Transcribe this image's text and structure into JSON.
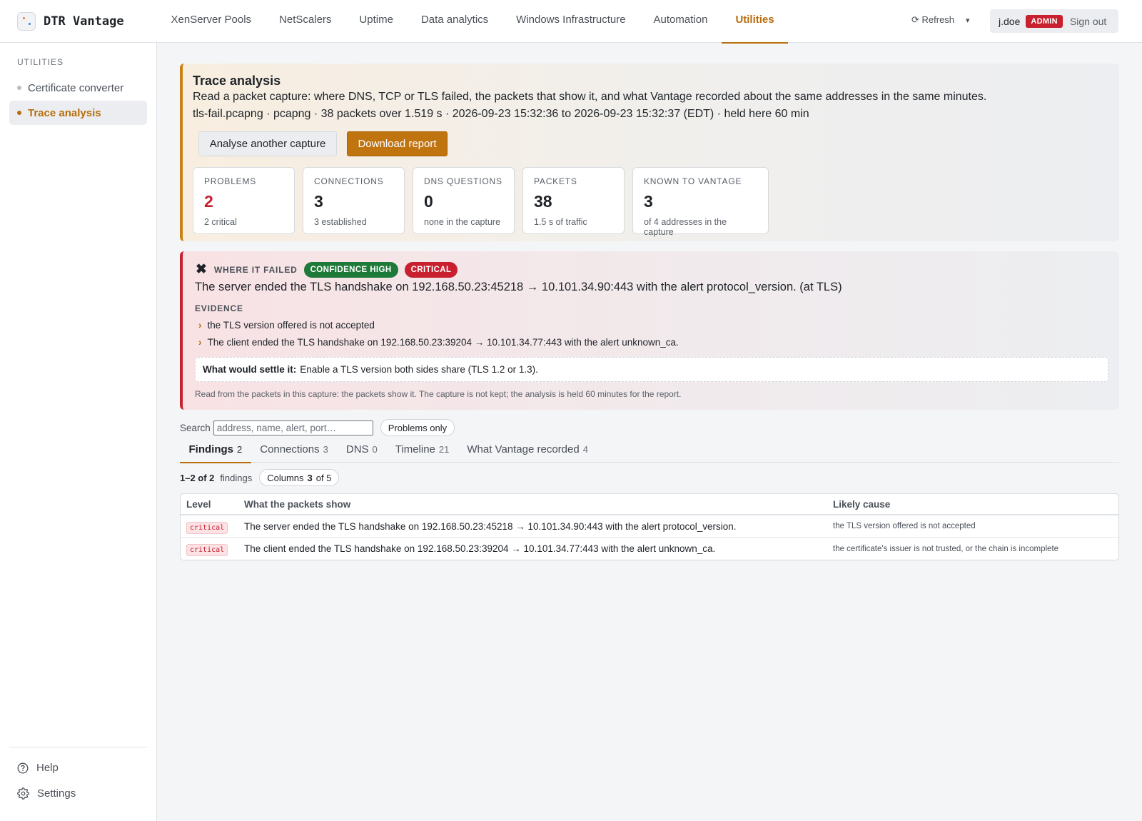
{
  "app": {
    "name": "DTR Vantage"
  },
  "nav": {
    "items": [
      {
        "label": "XenServer Pools",
        "active": false
      },
      {
        "label": "NetScalers",
        "active": false
      },
      {
        "label": "Uptime",
        "active": false
      },
      {
        "label": "Data analytics",
        "active": false
      },
      {
        "label": "Windows Infrastructure",
        "active": false
      },
      {
        "label": "Automation",
        "active": false
      },
      {
        "label": "Utilities",
        "active": true
      }
    ],
    "refresh_label": "⟳ Refresh",
    "refresh_caret": "▾",
    "user": "j.doe",
    "role_badge": "ADMIN",
    "signout_label": "Sign out"
  },
  "sidebar": {
    "heading": "UTILITIES",
    "items": [
      {
        "label": "Certificate converter",
        "active": false
      },
      {
        "label": "Trace analysis",
        "active": true
      }
    ],
    "footer": {
      "help_label": "Help",
      "settings_label": "Settings"
    }
  },
  "trace": {
    "title": "Trace analysis",
    "description": "Read a packet capture: where DNS, TCP or TLS failed, the packets that show it, and what Vantage recorded about the same addresses in the same minutes.",
    "meta": "tls-fail.pcapng · pcapng · 38 packets over 1.519 s · 2026-09-23 15:32:36 to 2026-09-23 15:32:37 (EDT) · held here 60 min",
    "analyse_button": "Analyse another capture",
    "download_button": "Download report",
    "stats": [
      {
        "label": "PROBLEMS",
        "value": "2",
        "sub": "2 critical"
      },
      {
        "label": "CONNECTIONS",
        "value": "3",
        "sub": "3 established"
      },
      {
        "label": "DNS QUESTIONS",
        "value": "0",
        "sub": "none in the capture"
      },
      {
        "label": "PACKETS",
        "value": "38",
        "sub": "1.5 s of traffic"
      },
      {
        "label": "KNOWN TO VANTAGE",
        "value": "3",
        "sub": "of 4 addresses in the capture"
      }
    ]
  },
  "failure": {
    "icon": "✖",
    "heading": "WHERE IT FAILED",
    "confidence_badge": "CONFIDENCE HIGH",
    "severity_badge": "CRITICAL",
    "statement": "The server ended the TLS handshake on 192.168.50.23:45218 → 10.101.34.90:443 with the alert protocol_version. (at TLS)",
    "evidence_heading": "EVIDENCE",
    "evidence": [
      "the TLS version offered is not accepted",
      "The client ended the TLS handshake on 192.168.50.23:39204 → 10.101.34.77:443 with the alert unknown_ca."
    ],
    "bullet_glyph": "›",
    "settle_label": "What would settle it:",
    "settle_text": "Enable a TLS version both sides share (TLS 1.2 or 1.3).",
    "note": "Read from the packets in this capture: the packets show it. The capture is not kept; the analysis is held 60 minutes for the report."
  },
  "search": {
    "label": "Search",
    "placeholder": "address, name, alert, port…",
    "value": "",
    "problems_only_label": "Problems only"
  },
  "tabs": [
    {
      "label": "Findings",
      "count": "2",
      "active": true
    },
    {
      "label": "Connections",
      "count": "3",
      "active": false
    },
    {
      "label": "DNS",
      "count": "0",
      "active": false
    },
    {
      "label": "Timeline",
      "count": "21",
      "active": false
    },
    {
      "label": "What Vantage recorded",
      "count": "4",
      "active": false
    }
  ],
  "findings": {
    "range": "1–2 of 2",
    "noun": "findings",
    "columns_label": "Columns",
    "columns_shown": "3",
    "columns_total": "of 5",
    "headers": [
      "Level",
      "What the packets show",
      "Likely cause"
    ],
    "rows": [
      {
        "level": "critical",
        "show": "The server ended the TLS handshake on 192.168.50.23:45218 → 10.101.34.90:443 with the alert protocol_version.",
        "cause": "the TLS version offered is not accepted"
      },
      {
        "level": "critical",
        "show": "The client ended the TLS handshake on 192.168.50.23:39204 → 10.101.34.77:443 with the alert unknown_ca.",
        "cause": "the certificate's issuer is not trusted, or the chain is incomplete"
      }
    ]
  },
  "colors": {
    "accent": "#b86e0c",
    "critical": "#c8202f",
    "confidence": "#1e7a38"
  }
}
